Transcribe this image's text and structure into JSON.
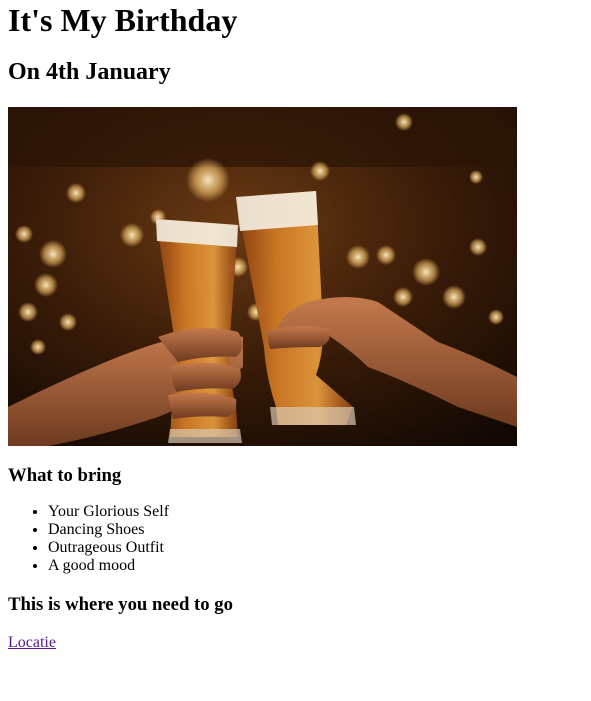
{
  "page": {
    "title": "It's My Birthday",
    "subtitle": "On 4th January"
  },
  "image": {
    "alt": "Two hands clinking glasses of beer in a bar",
    "colors": {
      "background_dark": "#1a0d05",
      "bokeh_warm": "#f5c26b",
      "beer": "#c76a1c",
      "foam": "#f3eee2",
      "skin": "#b06a43"
    }
  },
  "bring": {
    "heading": "What to bring",
    "items": [
      "Your Glorious Self",
      "Dancing Shoes",
      "Outrageous Outfit",
      "A good mood"
    ]
  },
  "where": {
    "heading": "This is where you need to go",
    "link_label": "Locatie",
    "link_color": "#551a8b"
  }
}
